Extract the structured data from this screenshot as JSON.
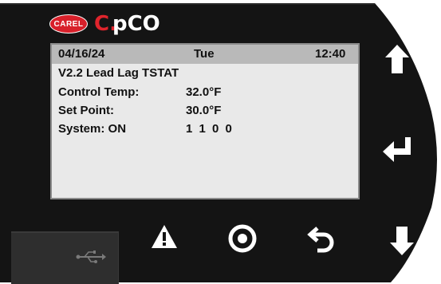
{
  "brand": {
    "badge_text": "CAREL",
    "product_prefix": "C.",
    "product_name": "pCO",
    "colors": {
      "badge": "#d8202a",
      "prefix": "#e0242c",
      "name": "#ffffff"
    }
  },
  "screen": {
    "date": "04/16/24",
    "day": "Tue",
    "time": "12:40",
    "title": "V2.2 Lead Lag TSTAT",
    "rows": [
      {
        "label": "Control Temp:",
        "value": "32.0°F"
      },
      {
        "label": "Set Point:",
        "value": "30.0°F"
      },
      {
        "label": "System: ON",
        "value": "1 1 0 0"
      }
    ],
    "colors": {
      "background": "#e9e9e9",
      "header": "#b9b9b9",
      "text": "#111111"
    }
  },
  "buttons": {
    "up": {
      "icon": "arrow-up-icon"
    },
    "enter": {
      "icon": "enter-icon"
    },
    "down": {
      "icon": "arrow-down-icon"
    },
    "alarm": {
      "icon": "alarm-warning-icon"
    },
    "program": {
      "icon": "program-circle-icon"
    },
    "escape": {
      "icon": "escape-back-icon"
    }
  },
  "usb": {
    "icon": "usb-icon"
  },
  "bezel_color": "#141414"
}
